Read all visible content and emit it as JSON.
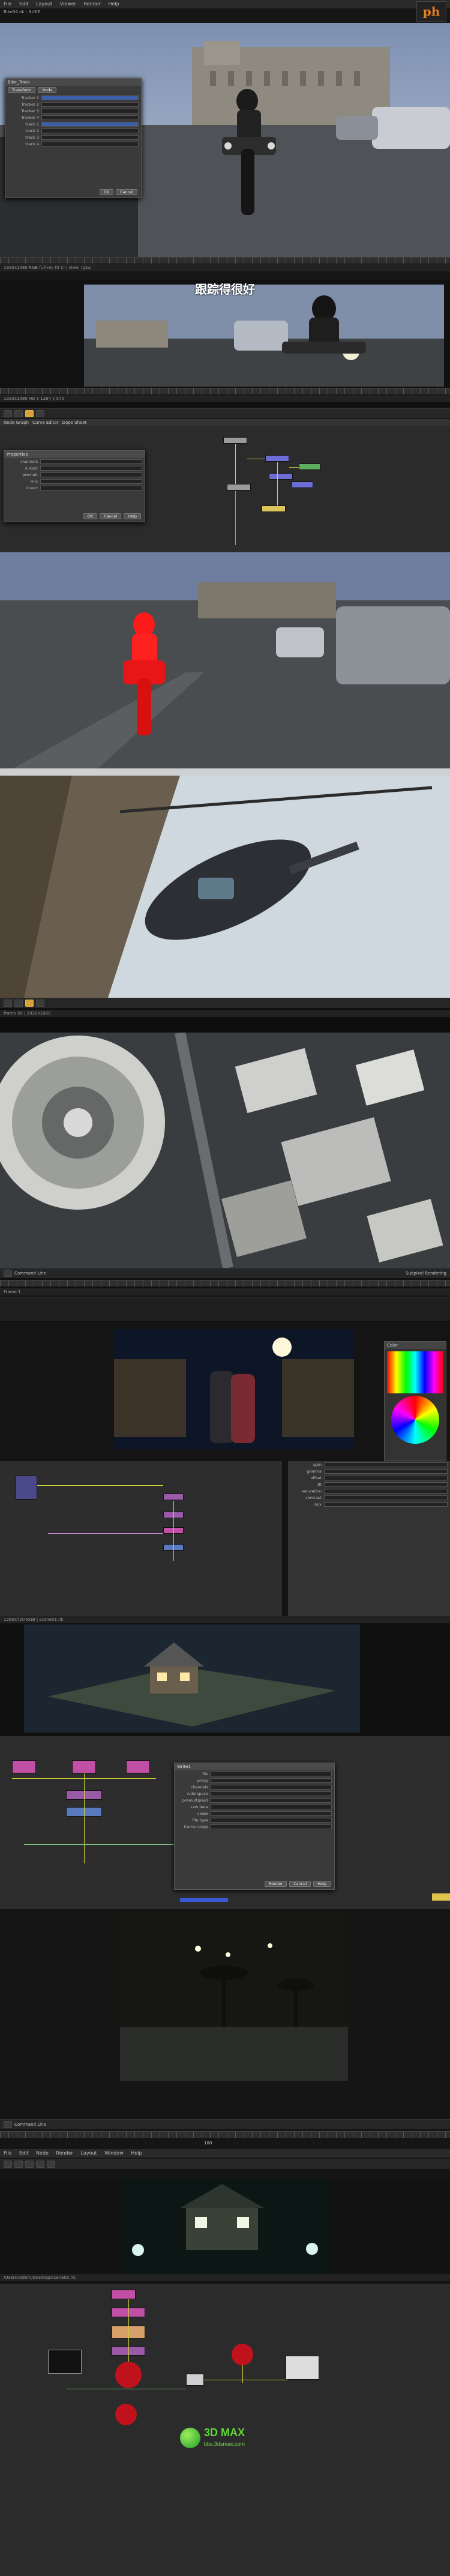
{
  "app": {
    "window_title": "Bike04.nk - NUKE",
    "brand_logo": "ph"
  },
  "panel1": {
    "menu_items": [
      "File",
      "Edit",
      "Layout",
      "Viewer",
      "Render",
      "Help"
    ],
    "dialog": {
      "title": "Bike_Track",
      "tabs": [
        "Transform",
        "Node"
      ],
      "rows": [
        {
          "label": "Tracker 1",
          "value": ""
        },
        {
          "label": "Tracker 2",
          "value": ""
        },
        {
          "label": "Tracker 3",
          "value": ""
        },
        {
          "label": "Tracker 4",
          "value": ""
        },
        {
          "label": "track 1",
          "value": ""
        },
        {
          "label": "track 2",
          "value": ""
        },
        {
          "label": "track 3",
          "value": ""
        },
        {
          "label": "track 4",
          "value": ""
        }
      ],
      "buttons": [
        "OK",
        "Cancel"
      ]
    },
    "status": "1920x1080 RGB full res (0 1) | view: rgba"
  },
  "panel2": {
    "subtitle": "跟踪得很好",
    "status": "1920x1080 HD  x 1264 y 570"
  },
  "panel3": {
    "tabs": [
      "Node Graph",
      "Curve Editor",
      "Dope Sheet"
    ],
    "dialog": {
      "title": "Properties",
      "rows": [
        {
          "label": "channels",
          "value": ""
        },
        {
          "label": "output",
          "value": ""
        },
        {
          "label": "premult",
          "value": ""
        },
        {
          "label": "mix",
          "value": ""
        },
        {
          "label": "invert",
          "value": ""
        }
      ],
      "buttons": [
        "OK",
        "Cancel",
        "Help"
      ]
    }
  },
  "panel4": {
    "status": "frame 50 | 1920x1080"
  },
  "panel5": {
    "panel_tab": "Command Line",
    "status_left": "Frame 1",
    "status_right": "Subpixel Rendering"
  },
  "panel6": {
    "color_label": "Color",
    "prop_rows": [
      "gain",
      "gamma",
      "offset",
      "lift",
      "saturation",
      "contrast",
      "mix"
    ]
  },
  "panel7": {
    "status": "1280x720 RGB | scene01.nk"
  },
  "panel8": {
    "dialog_title": "Write1",
    "rows": [
      "file",
      "proxy",
      "channels",
      "colorspace",
      "premultiplied",
      "raw data",
      "views",
      "file type",
      "frame range"
    ],
    "buttons": [
      "Render",
      "Cancel",
      "Help"
    ]
  },
  "panel9": {
    "panel_tab": "Command Line",
    "frame_label": "100",
    "menu_items": [
      "File",
      "Edit",
      "Node",
      "Render",
      "Layout",
      "Window",
      "Help"
    ]
  },
  "panel10": {
    "status": "/Users/admin/Desktop/scene05.nk",
    "watermark_main": "3D MAX",
    "watermark_sub": "bbs.3dsmax.com"
  }
}
